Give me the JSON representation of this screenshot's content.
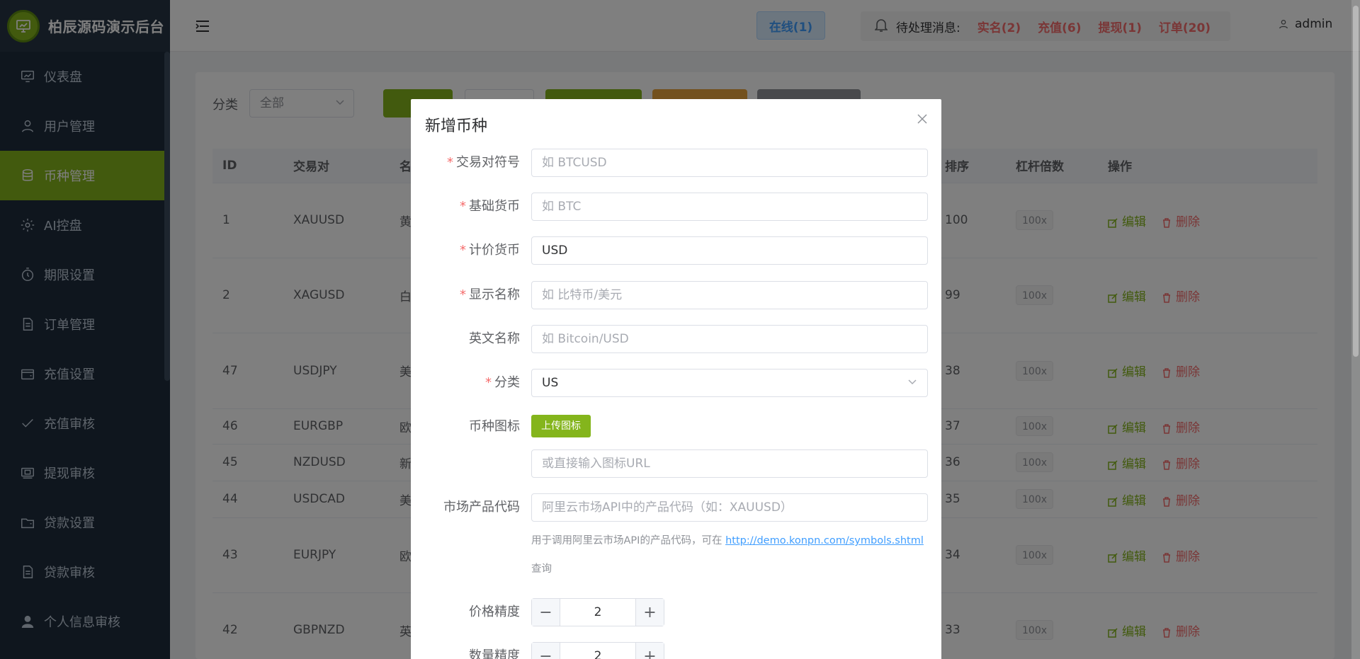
{
  "sidebar": {
    "brand": "柏辰源码演示后台",
    "items": [
      {
        "label": "仪表盘",
        "icon": "dashboard-icon"
      },
      {
        "label": "用户管理",
        "icon": "user-icon"
      },
      {
        "label": "币种管理",
        "icon": "database-icon"
      },
      {
        "label": "AI控盘",
        "icon": "gear-icon"
      },
      {
        "label": "期限设置",
        "icon": "timer-icon"
      },
      {
        "label": "订单管理",
        "icon": "document-icon"
      },
      {
        "label": "充值设置",
        "icon": "wallet-icon"
      },
      {
        "label": "充值审核",
        "icon": "check-icon"
      },
      {
        "label": "提现审核",
        "icon": "withdraw-icon"
      },
      {
        "label": "贷款设置",
        "icon": "folder-icon"
      },
      {
        "label": "贷款审核",
        "icon": "document-icon"
      },
      {
        "label": "个人信息审核",
        "icon": "person-icon"
      }
    ],
    "active_index": 2
  },
  "header": {
    "online": "在线(1)",
    "pending_label": "待处理消息:",
    "realname": "实名(2)",
    "recharge": "充值(6)",
    "withdraw": "提现(1)",
    "orders": "订单(20)",
    "user": "admin"
  },
  "filter": {
    "label": "分类",
    "selected": "全部"
  },
  "table": {
    "headers": [
      "ID",
      "交易对",
      "名",
      "",
      "",
      "",
      "",
      "",
      "",
      "",
      "排序",
      "杠杆倍数",
      "操作"
    ],
    "edit_label": "编辑",
    "delete_label": "删除",
    "rows": [
      {
        "id": "1",
        "pair": "XAUUSD",
        "name": "黄",
        "sort": "100",
        "leverage": "100x"
      },
      {
        "id": "2",
        "pair": "XAGUSD",
        "name": "白",
        "sort": "99",
        "leverage": "100x"
      },
      {
        "id": "47",
        "pair": "USDJPY",
        "name": "美",
        "sort": "38",
        "leverage": "100x"
      },
      {
        "id": "46",
        "pair": "EURGBP",
        "name": "欧",
        "sort": "37",
        "leverage": "100x"
      },
      {
        "id": "45",
        "pair": "NZDUSD",
        "name": "新",
        "sort": "36",
        "leverage": "100x"
      },
      {
        "id": "44",
        "pair": "USDCAD",
        "name": "美",
        "sort": "35",
        "leverage": "100x"
      },
      {
        "id": "43",
        "pair": "EURJPY",
        "name": "欧",
        "sort": "34",
        "leverage": "100x"
      },
      {
        "id": "42",
        "pair": "GBPNZD",
        "name": "英",
        "sort": "33",
        "leverage": "100x"
      }
    ]
  },
  "dialog": {
    "title": "新增币种",
    "fields": {
      "symbol": {
        "label": "交易对符号",
        "placeholder": "如 BTCUSD",
        "value": ""
      },
      "base": {
        "label": "基础货币",
        "placeholder": "如 BTC",
        "value": ""
      },
      "quote": {
        "label": "计价货币",
        "placeholder": "",
        "value": "USD"
      },
      "display_name": {
        "label": "显示名称",
        "placeholder": "如 比特币/美元",
        "value": ""
      },
      "english_name": {
        "label": "英文名称",
        "placeholder": "如 Bitcoin/USD",
        "value": ""
      },
      "category": {
        "label": "分类",
        "value": "US"
      },
      "icon": {
        "label": "币种图标",
        "upload_label": "上传图标",
        "url_placeholder": "或直接输入图标URL"
      },
      "market_code": {
        "label": "市场产品代码",
        "placeholder": "阿里云市场API中的产品代码（如：XAUUSD）"
      },
      "help_prefix": "用于调用阿里云市场API的产品代码，可在 ",
      "help_link": "http://demo.konpn.com/symbols.shtml",
      "help_suffix": " 查询",
      "price_precision": {
        "label": "价格精度",
        "value": "2"
      },
      "qty_precision": {
        "label": "数量精度",
        "value": "2"
      }
    }
  }
}
